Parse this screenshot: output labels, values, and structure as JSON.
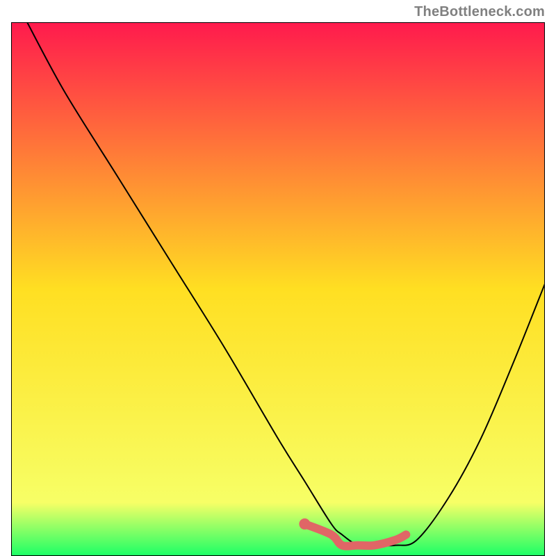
{
  "attribution": "TheBottleneck.com",
  "chart_data": {
    "type": "line",
    "title": "",
    "xlabel": "",
    "ylabel": "",
    "xlim": [
      0,
      100
    ],
    "ylim": [
      0,
      100
    ],
    "gradient_stops": [
      {
        "offset": 0,
        "color": "#ff1a4d"
      },
      {
        "offset": 50,
        "color": "#ffdf22"
      },
      {
        "offset": 90,
        "color": "#f7ff66"
      },
      {
        "offset": 100,
        "color": "#1aff66"
      }
    ],
    "series": [
      {
        "name": "bottleneck-curve",
        "x": [
          3,
          10,
          20,
          30,
          40,
          50,
          55,
          60,
          62,
          65,
          68,
          72,
          76,
          82,
          88,
          94,
          100
        ],
        "y": [
          100,
          87,
          71,
          55,
          39,
          22,
          14,
          6,
          4,
          2,
          2,
          2,
          3,
          11,
          22,
          36,
          51
        ]
      }
    ],
    "highlight_segment": {
      "name": "sweet-spot",
      "x": [
        55,
        60,
        62,
        65,
        68,
        72,
        74
      ],
      "y": [
        6,
        4,
        2,
        2,
        2,
        3,
        4
      ]
    },
    "highlight_dot": {
      "x": 55,
      "y": 6
    }
  }
}
